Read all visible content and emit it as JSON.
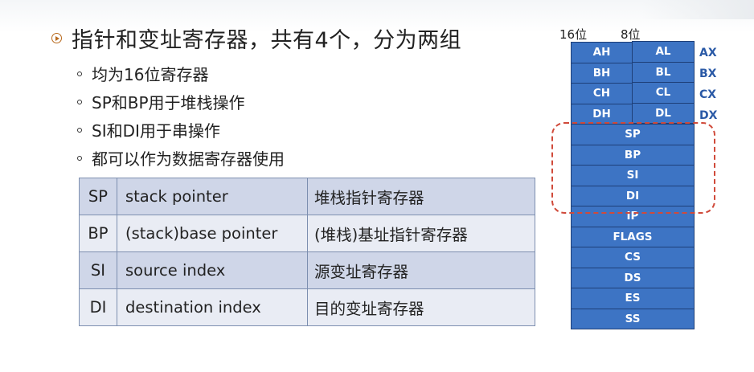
{
  "title": "指针和变址寄存器，共有4个，分为两组",
  "bullets": [
    "均为16位寄存器",
    "SP和BP用于堆栈操作",
    "SI和DI用于串操作",
    "都可以作为数据寄存器使用"
  ],
  "table": [
    [
      "SP",
      "stack pointer",
      "堆栈指针寄存器"
    ],
    [
      "BP",
      "(stack)base pointer",
      "(堆栈)基址指针寄存器"
    ],
    [
      "SI",
      "source index",
      "源变址寄存器"
    ],
    [
      "DI",
      "destination index",
      "目的变址寄存器"
    ]
  ],
  "diagram": {
    "header_left": "16位",
    "header_right": "8位",
    "pairs": [
      {
        "high": "AH",
        "low": "AL",
        "name": "AX"
      },
      {
        "high": "BH",
        "low": "BL",
        "name": "BX"
      },
      {
        "high": "CH",
        "low": "CL",
        "name": "CX"
      },
      {
        "high": "DH",
        "low": "DL",
        "name": "DX"
      }
    ],
    "singles": [
      "SP",
      "BP",
      "SI",
      "DI",
      "IP",
      "FLAGS",
      "CS",
      "DS",
      "ES",
      "SS"
    ],
    "cell_color": "#3d74c4",
    "label_color": "#2a59a6",
    "highlight_color": "#d04a3a"
  }
}
